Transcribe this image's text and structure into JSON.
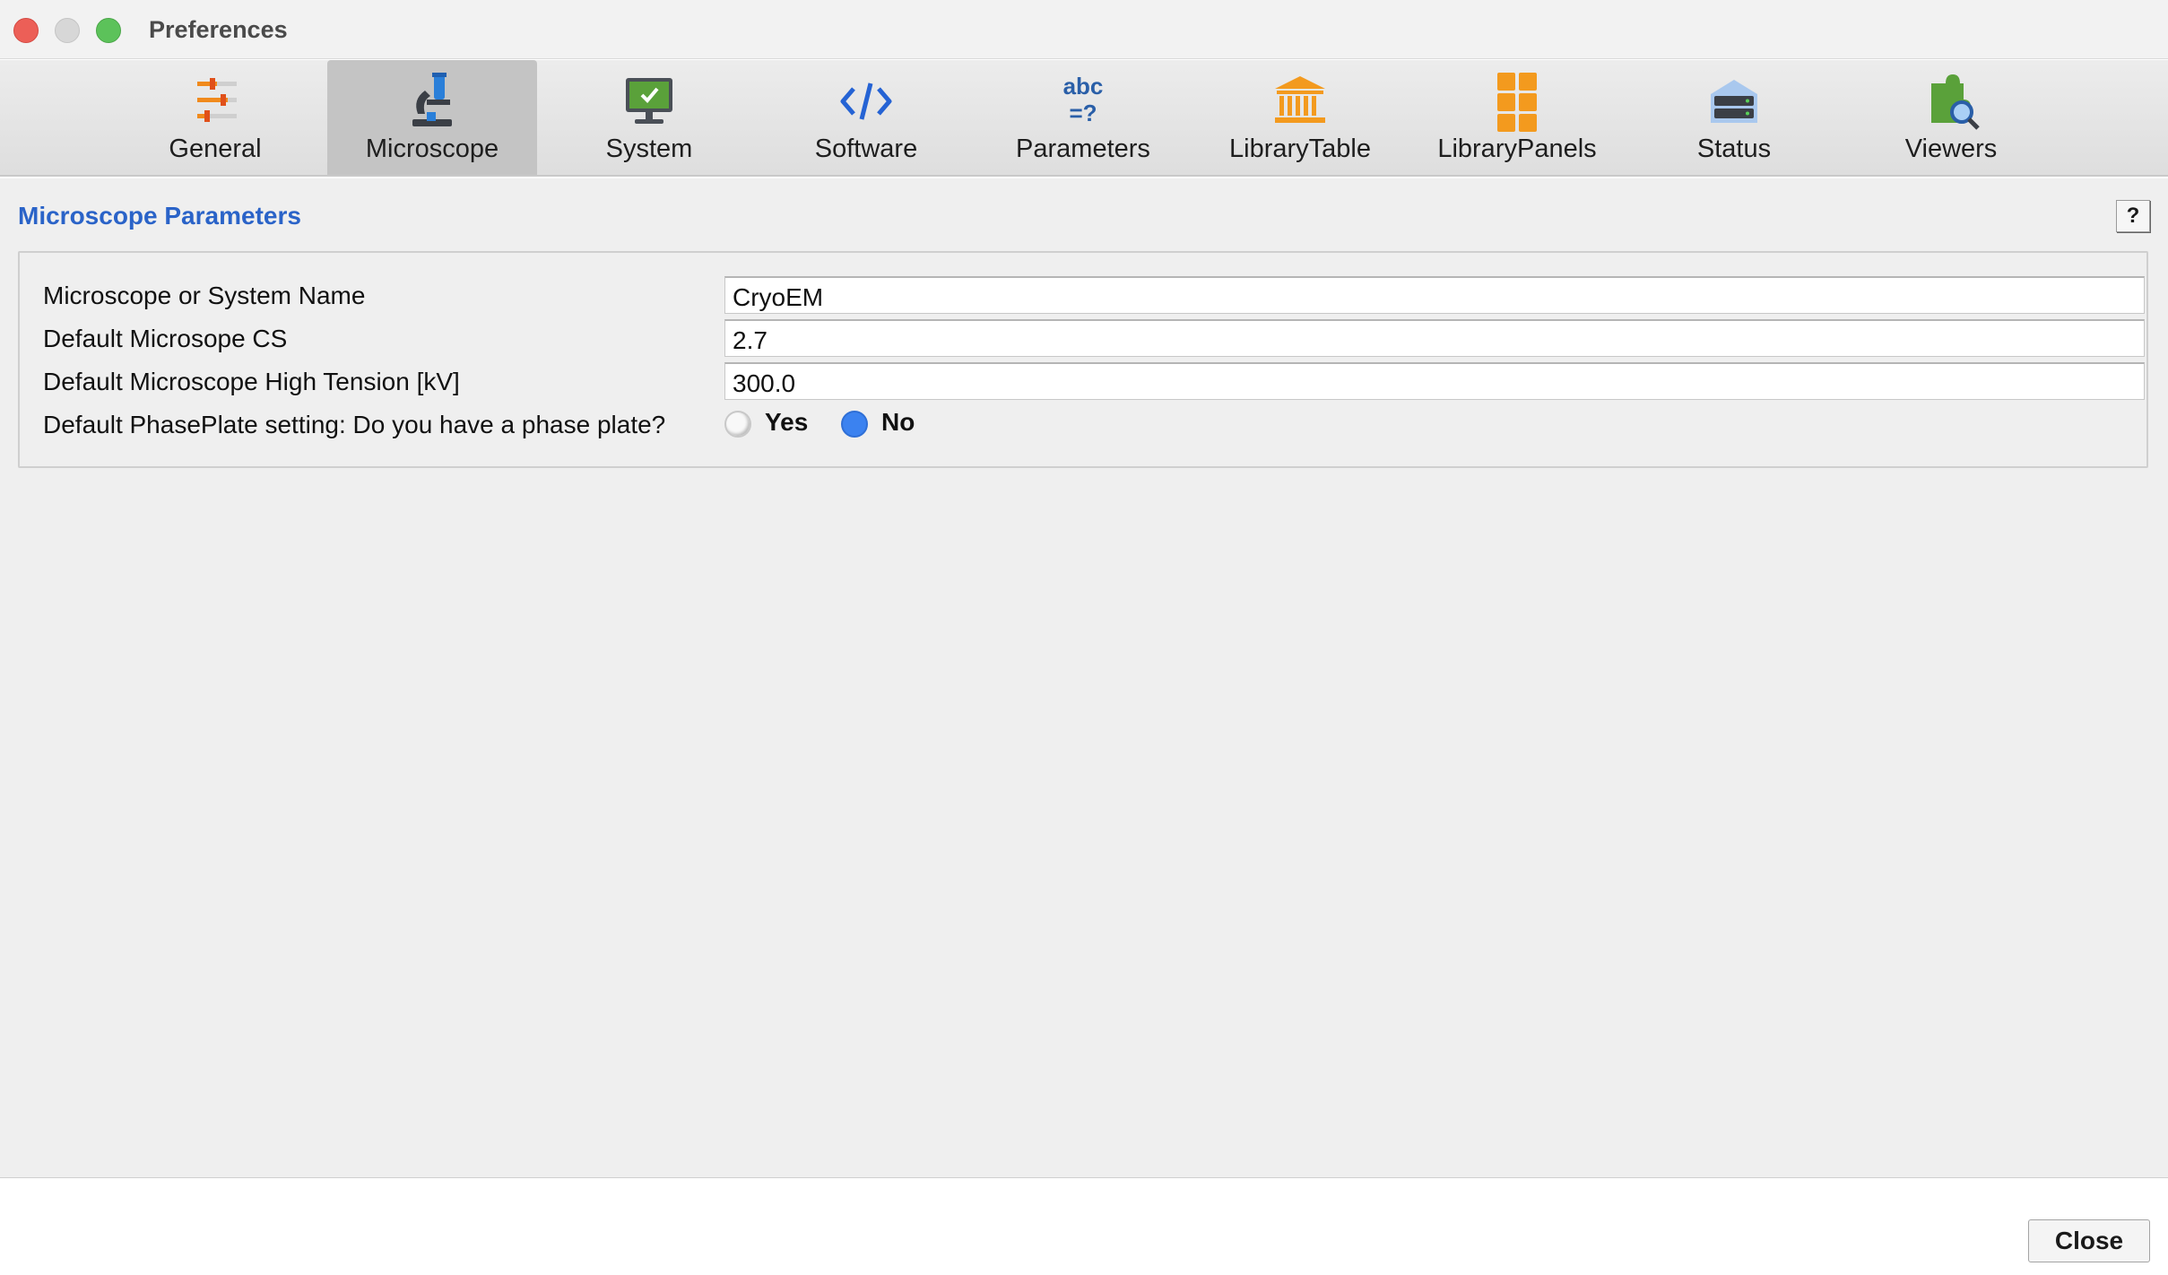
{
  "window": {
    "title": "Preferences"
  },
  "toolbar": {
    "active_tab": "Microscope",
    "tabs": [
      {
        "label": "General",
        "icon": "sliders-icon"
      },
      {
        "label": "Microscope",
        "icon": "microscope-icon"
      },
      {
        "label": "System",
        "icon": "monitor-check-icon"
      },
      {
        "label": "Software",
        "icon": "code-icon"
      },
      {
        "label": "Parameters",
        "icon": "abc-equals-icon"
      },
      {
        "label": "LibraryTable",
        "icon": "library-icon"
      },
      {
        "label": "LibraryPanels",
        "icon": "panels-grid-icon"
      },
      {
        "label": "Status",
        "icon": "server-status-icon"
      },
      {
        "label": "Viewers",
        "icon": "puzzle-search-icon"
      }
    ]
  },
  "section": {
    "title": "Microscope Parameters",
    "help_label": "?"
  },
  "form": {
    "system_name": {
      "label": "Microscope or System Name",
      "value": "CryoEM"
    },
    "cs": {
      "label": "Default Microsope CS",
      "value": "2.7"
    },
    "high_tension": {
      "label": "Default Microscope High Tension [kV]",
      "value": "300.0"
    },
    "phase_plate": {
      "label": "Default PhasePlate setting: Do you have a phase plate?",
      "options": [
        "Yes",
        "No"
      ],
      "selected": "No"
    }
  },
  "footer": {
    "close_label": "Close"
  },
  "colors": {
    "accent": "#2a63c8",
    "radio_selected": "#3b82f0",
    "active_tab_bg": "#c4c4c4",
    "icon_orange": "#f39a1e",
    "icon_blue": "#2563d4",
    "icon_green": "#5aa13a"
  }
}
